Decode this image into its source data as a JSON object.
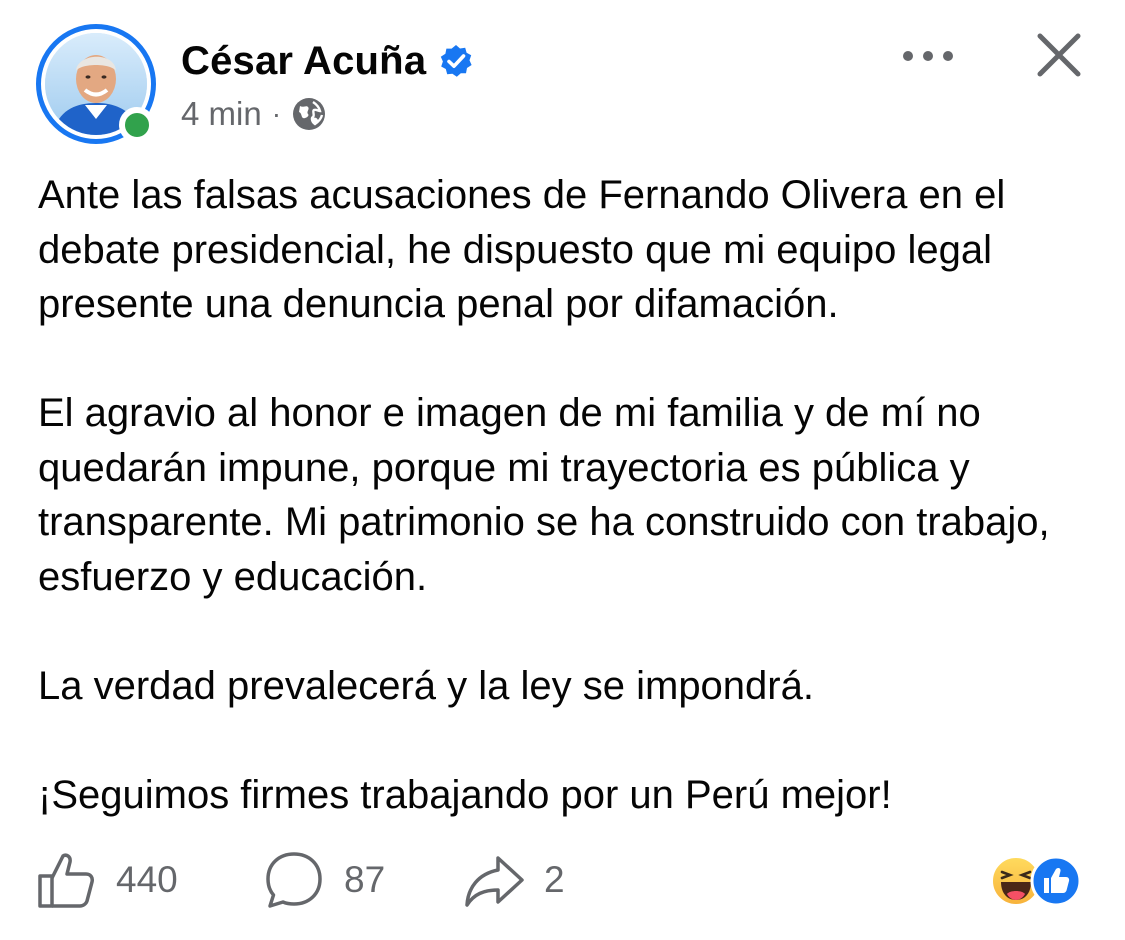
{
  "post": {
    "author": {
      "name": "César Acuña",
      "verified": true,
      "online": true
    },
    "time": "4 min",
    "separator": "·",
    "audience_icon": "globe-icon",
    "paragraphs": [
      "Ante las falsas acusaciones de Fernando Olivera en el debate presidencial, he dispuesto que mi equipo legal presente una denuncia penal por difamación.",
      "El agravio al honor e imagen de mi familia y de mí no quedarán impune, porque mi trayectoria es pública y transparente. Mi patrimonio se ha construido con trabajo, esfuerzo y educación.",
      "La verdad prevalecerá y la ley se impondrá.",
      "¡Seguimos firmes trabajando por un Perú mejor!"
    ],
    "actions": {
      "like_count": "440",
      "comment_count": "87",
      "share_count": "2"
    },
    "reactions": [
      "haha-reaction-icon",
      "like-reaction-icon"
    ]
  },
  "colors": {
    "brand_blue": "#1877f2",
    "online_green": "#31a24c",
    "secondary_text": "#65676b",
    "primary_text": "#050505"
  }
}
